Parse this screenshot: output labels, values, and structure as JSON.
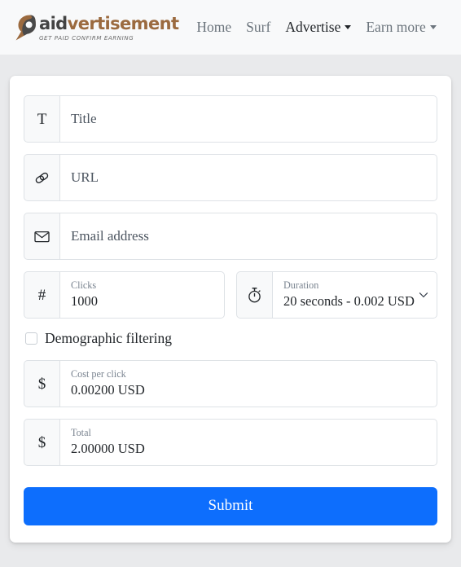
{
  "navbar": {
    "brand": {
      "word_part1": "p",
      "word_part2": "aid",
      "word_part3": "vertisement",
      "tagline": "GET PAID CONFIRM EARNING",
      "mark_icon": "pin-drop-logo-icon",
      "color_dark": "#434343",
      "color_accent": "#9b6a3f"
    },
    "links": [
      {
        "label": "Home",
        "active": false,
        "dropdown": false
      },
      {
        "label": "Surf",
        "active": false,
        "dropdown": false
      },
      {
        "label": "Advertise",
        "active": true,
        "dropdown": true
      },
      {
        "label": "Earn more",
        "active": false,
        "dropdown": true
      }
    ]
  },
  "form": {
    "title_field": {
      "icon": "text-T-icon",
      "icon_glyph": "T",
      "placeholder": "Title",
      "value": ""
    },
    "url_field": {
      "icon": "link-chain-icon",
      "placeholder": "URL",
      "value": ""
    },
    "email_field": {
      "icon": "envelope-icon",
      "placeholder": "Email address",
      "value": ""
    },
    "clicks_field": {
      "icon": "hash-icon",
      "icon_glyph": "#",
      "label": "Clicks",
      "value": "1000"
    },
    "duration_field": {
      "icon": "stopwatch-icon",
      "label": "Duration",
      "value": "20 seconds - 0.002 USD",
      "chevron": "chevron-down-icon"
    },
    "demographic_checkbox": {
      "label": "Demographic filtering",
      "checked": false
    },
    "cost_per_click_field": {
      "icon": "dollar-icon",
      "icon_glyph": "$",
      "label": "Cost per click",
      "value": "0.00200 USD"
    },
    "total_field": {
      "icon": "dollar-icon",
      "icon_glyph": "$",
      "label": "Total",
      "value": "2.00000 USD"
    },
    "submit_button": {
      "label": "Submit",
      "color": "#0d6efd"
    }
  }
}
